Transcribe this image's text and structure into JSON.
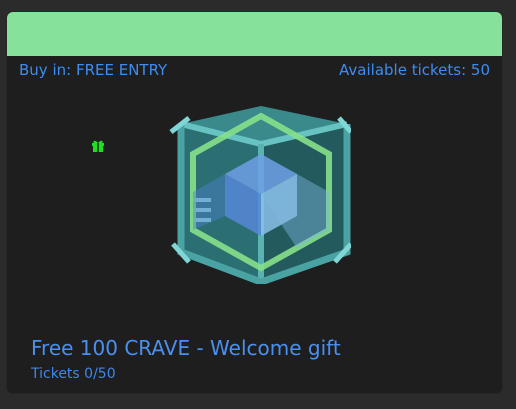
{
  "card": {
    "buy_in_label": "Buy in:",
    "buy_in_value": "FREE ENTRY",
    "available_label": "Available tickets:",
    "available_value": "50",
    "title": "Free 100 CRAVE - Welcome gift",
    "tickets_text": "Tickets 0/50",
    "tickets_sold": 0,
    "tickets_total": 50
  },
  "icons": {
    "gift": "gift-icon",
    "crate": "loot-crate-icon"
  },
  "colors": {
    "header": "#86e29b",
    "accent_text": "#3f8cf0",
    "gift_icon": "#22dd22",
    "card_bg": "#1e1e1f",
    "page_bg": "#2b2b2b"
  }
}
